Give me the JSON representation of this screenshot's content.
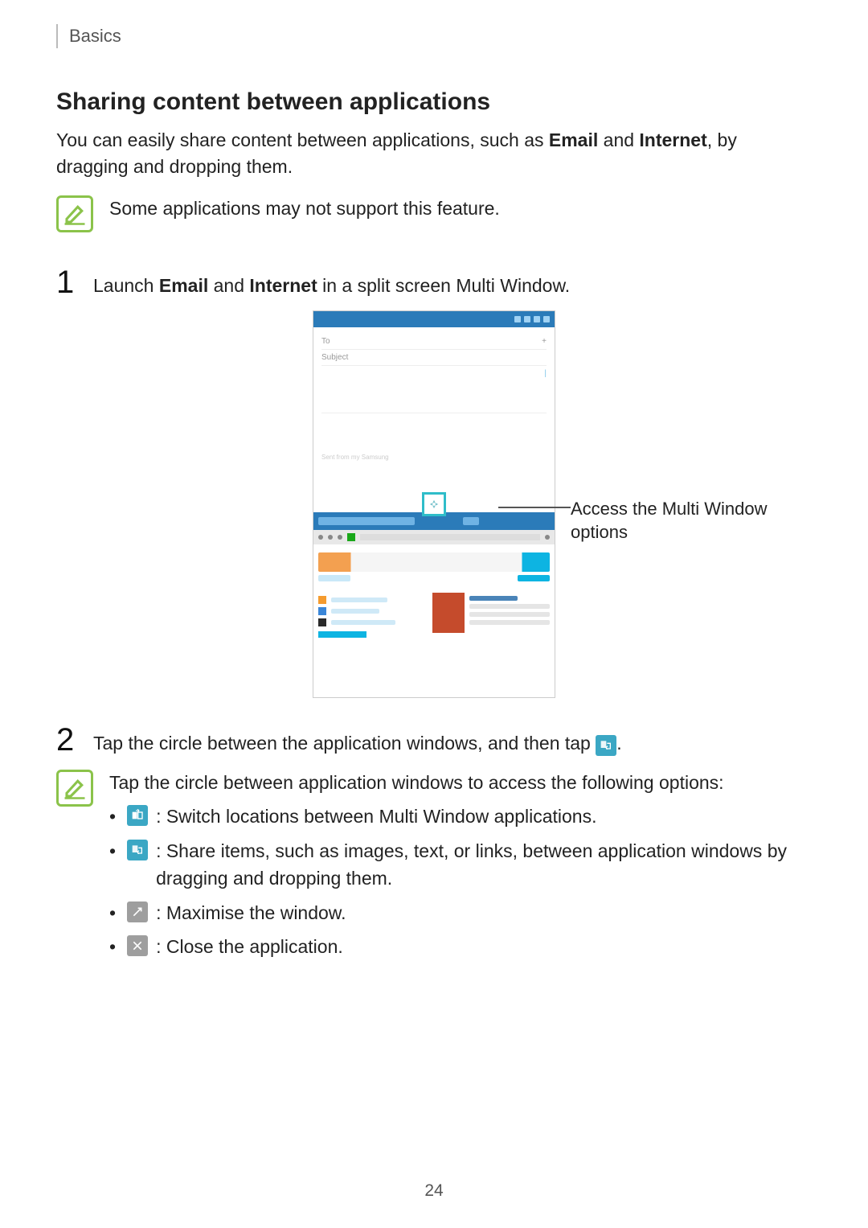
{
  "breadcrumb": "Basics",
  "heading": "Sharing content between applications",
  "intro": {
    "pre": "You can easily share content between applications, such as ",
    "b1": "Email",
    "mid": " and ",
    "b2": "Internet",
    "post": ", by dragging and dropping them."
  },
  "tip1": "Some applications may not support this feature.",
  "step1": {
    "num": "1",
    "pre": "Launch ",
    "b1": "Email",
    "mid": " and ",
    "b2": "Internet",
    "post": " in a split screen Multi Window."
  },
  "callout": "Access the Multi Window options",
  "step2": {
    "num": "2",
    "pre": "Tap the circle between the application windows, and then tap ",
    "post": "."
  },
  "tip2_lead": "Tap the circle between application windows to access the following options:",
  "opt_switch": ": Switch locations between Multi Window applications.",
  "opt_share": ": Share items, such as images, text, or links, between application windows by dragging and dropping them.",
  "opt_max": ": Maximise the window.",
  "opt_close": ": Close the application.",
  "page_number": "24"
}
